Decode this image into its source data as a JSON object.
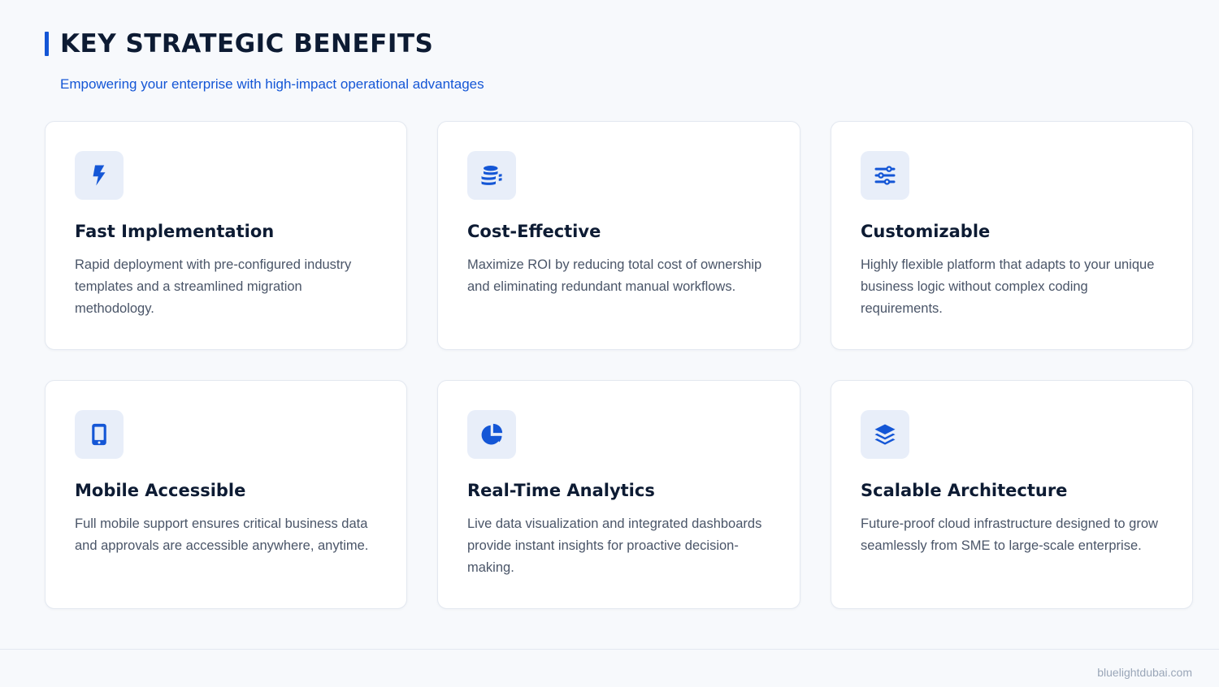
{
  "header": {
    "title": "KEY STRATEGIC BENEFITS",
    "subtitle": "Empowering your enterprise with high-impact operational advantages"
  },
  "accent_color": "#1456d6",
  "cards": [
    {
      "icon": "lightning-bolt-icon",
      "title": "Fast Implementation",
      "description": "Rapid deployment with pre-configured industry templates and a streamlined migration methodology."
    },
    {
      "icon": "coins-stack-icon",
      "title": "Cost-Effective",
      "description": "Maximize ROI by reducing total cost of ownership and eliminating redundant manual workflows."
    },
    {
      "icon": "sliders-icon",
      "title": "Customizable",
      "description": "Highly flexible platform that adapts to your unique business logic without complex coding requirements."
    },
    {
      "icon": "mobile-phone-icon",
      "title": "Mobile Accessible",
      "description": "Full mobile support ensures critical business data and approvals are accessible anywhere, anytime."
    },
    {
      "icon": "pie-chart-icon",
      "title": "Real-Time Analytics",
      "description": "Live data visualization and integrated dashboards provide instant insights for proactive decision-making."
    },
    {
      "icon": "layers-icon",
      "title": "Scalable Architecture",
      "description": "Future-proof cloud infrastructure designed to grow seamlessly from SME to large-scale enterprise."
    }
  ],
  "footer": {
    "site": "bluelightdubai.com"
  }
}
